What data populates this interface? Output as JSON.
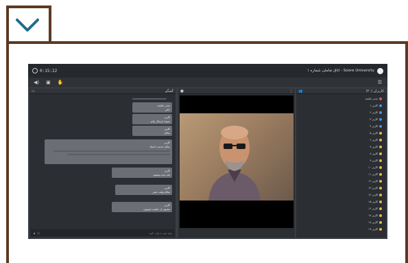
{
  "session": {
    "timer": "0:15:22",
    "title": "اتاق تعاملی شماره ۱ - Soore University",
    "chat_header": "گفتگو",
    "users_header": "کاربران (۴۰)",
    "chat_placeholder": "پیام خود را وارد کنید"
  },
  "chat_messages": [
    {
      "author": "مدیر جلسه",
      "text": "دکتر"
    },
    {
      "author": "کاربر",
      "text": "نمونه ارسال پیام"
    },
    {
      "author": "کاربر",
      "text": "سلام"
    },
    {
      "author": "کاربر",
      "text": "سلام خدمت استاد"
    },
    {
      "author": "کاربر",
      "text": "بله دیده میشود"
    },
    {
      "author": "کاربر",
      "text": "سلام وقت بخیر"
    },
    {
      "author": "کاربر",
      "text": "ممنون از جلسه خوبتون"
    }
  ],
  "users": [
    {
      "name": "مدیر جلسه",
      "color": "#e05a4a"
    },
    {
      "name": "کاربر ۱",
      "color": "#4a8fe0"
    },
    {
      "name": "کاربر ۲",
      "color": "#4a8fe0"
    },
    {
      "name": "کاربر ۳",
      "color": "#4a8fe0"
    },
    {
      "name": "کاربر ۴",
      "color": "#4a8fe0"
    },
    {
      "name": "کاربر ۵",
      "color": "#e0b64a"
    },
    {
      "name": "کاربر ۶",
      "color": "#e0b64a"
    },
    {
      "name": "کاربر ۷",
      "color": "#e0b64a"
    },
    {
      "name": "کاربر ۸",
      "color": "#e0b64a"
    },
    {
      "name": "کاربر ۹",
      "color": "#e0b64a"
    },
    {
      "name": "کاربر ۱۰",
      "color": "#e0b64a"
    },
    {
      "name": "کاربر ۱۱",
      "color": "#e0b64a"
    },
    {
      "name": "کاربر ۱۲",
      "color": "#e0b64a"
    },
    {
      "name": "کاربر ۱۳",
      "color": "#e0b64a"
    },
    {
      "name": "کاربر ۱۴",
      "color": "#e0b64a"
    },
    {
      "name": "کاربر ۱۵",
      "color": "#e0b64a"
    },
    {
      "name": "کاربر ۱۶",
      "color": "#e0b64a"
    },
    {
      "name": "کاربر ۱۷",
      "color": "#e0b64a"
    },
    {
      "name": "کاربر ۱۸",
      "color": "#e0b64a"
    },
    {
      "name": "کاربر ۱۹",
      "color": "#e0b64a"
    }
  ],
  "icons": [
    "chevron-down-icon",
    "clock-icon",
    "logo-icon",
    "speaker-icon",
    "screen-share-icon",
    "hand-icon",
    "menu-icon",
    "chat-icon",
    "camera-icon",
    "users-icon",
    "send-icon",
    "emoji-icon"
  ],
  "colors": {
    "frame": "#5b3a22",
    "chevron": "#1f6c8a",
    "app_bg": "#3a3d42"
  }
}
